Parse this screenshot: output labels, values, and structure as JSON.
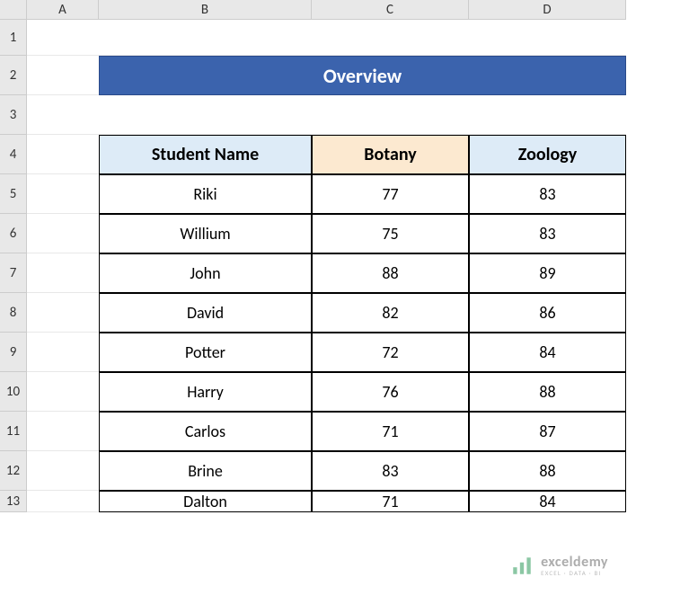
{
  "columns": [
    "",
    "A",
    "B",
    "C",
    "D"
  ],
  "rows": [
    "1",
    "2",
    "3",
    "4",
    "5",
    "6",
    "7",
    "8",
    "9",
    "10",
    "11",
    "12",
    "13"
  ],
  "title": "Overview",
  "headers": {
    "name": "Student Name",
    "col1": "Botany",
    "col2": "Zoology"
  },
  "students": [
    {
      "name": "Riki",
      "botany": "77",
      "zoology": "83"
    },
    {
      "name": "Willium",
      "botany": "75",
      "zoology": "83"
    },
    {
      "name": "John",
      "botany": "88",
      "zoology": "89"
    },
    {
      "name": "David",
      "botany": "82",
      "zoology": "86"
    },
    {
      "name": "Potter",
      "botany": "72",
      "zoology": "84"
    },
    {
      "name": "Harry",
      "botany": "76",
      "zoology": "88"
    },
    {
      "name": "Carlos",
      "botany": "71",
      "zoology": "87"
    },
    {
      "name": "Brine",
      "botany": "83",
      "zoology": "88"
    },
    {
      "name": "Dalton",
      "botany": "71",
      "zoology": "84"
    }
  ],
  "watermark": {
    "brand": "exceldemy",
    "tag": "EXCEL · DATA · BI"
  }
}
